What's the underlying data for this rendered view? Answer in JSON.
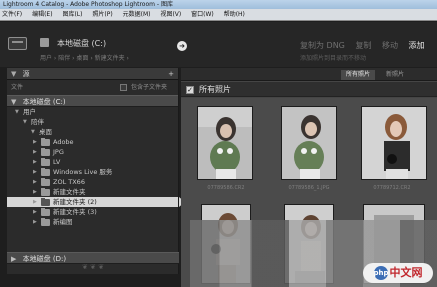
{
  "window": {
    "title": "Lightroom 4 Catalog - Adobe Photoshop Lightroom - 图库"
  },
  "menu": [
    "文件(F)",
    "编辑(E)",
    "图库(L)",
    "照片(P)",
    "元数据(M)",
    "视图(V)",
    "窗口(W)",
    "帮助(H)"
  ],
  "header": {
    "source_title": "本地磁盘 (C:)",
    "source_path": "用户 › 陪伴 › 桌面 › 新建文件夹 ›",
    "modes": [
      {
        "label": "复制为 DNG",
        "active": false
      },
      {
        "label": "复制",
        "active": false
      },
      {
        "label": "移动",
        "active": false
      },
      {
        "label": "添加",
        "active": true
      }
    ],
    "modes_sub": "添加照片到目录而不移动"
  },
  "left_panel": {
    "header": "源",
    "plus": "+",
    "filter_label": "文件",
    "include_subfolders": "包含子文件夹",
    "volume_c": "本地磁盘 (C:)",
    "volume_d": "本地磁盘 (D:)",
    "tree": [
      {
        "label": "用户",
        "depth": 1,
        "expanded": true,
        "folder": false
      },
      {
        "label": "陪伴",
        "depth": 2,
        "expanded": true,
        "folder": false
      },
      {
        "label": "桌面",
        "depth": 3,
        "expanded": true,
        "folder": false
      },
      {
        "label": "Adobe",
        "depth": 4,
        "expanded": false,
        "folder": true
      },
      {
        "label": "JPG",
        "depth": 4,
        "expanded": false,
        "folder": true
      },
      {
        "label": "LV",
        "depth": 4,
        "expanded": false,
        "folder": true
      },
      {
        "label": "Windows Live 服务",
        "depth": 4,
        "expanded": false,
        "folder": true
      },
      {
        "label": "ZOL TX66",
        "depth": 4,
        "expanded": false,
        "folder": true
      },
      {
        "label": "新建文件夹",
        "depth": 4,
        "expanded": false,
        "folder": true
      },
      {
        "label": "新建文件夹 (2)",
        "depth": 4,
        "expanded": false,
        "folder": true,
        "selected": true
      },
      {
        "label": "新建文件夹 (3)",
        "depth": 4,
        "expanded": false,
        "folder": true
      },
      {
        "label": "新编图",
        "depth": 4,
        "expanded": false,
        "folder": true
      }
    ]
  },
  "main": {
    "tabs": [
      {
        "label": "所有照片",
        "active": true
      },
      {
        "label": "新照片",
        "active": false
      }
    ],
    "all_photos_label": "所有照片",
    "check_mark": "✓",
    "photos": [
      {
        "filename": "07789586.CR2"
      },
      {
        "filename": "07789586_1.JPG"
      },
      {
        "filename": "07789712.CR2"
      },
      {
        "filename": ""
      },
      {
        "filename": ""
      },
      {
        "filename": ""
      }
    ]
  },
  "watermark": {
    "text": "中文网",
    "logo": "php"
  },
  "colors": {
    "accent": "#e8e8e8",
    "panel": "#2b2b2b",
    "selected": "#d6d6d6"
  }
}
